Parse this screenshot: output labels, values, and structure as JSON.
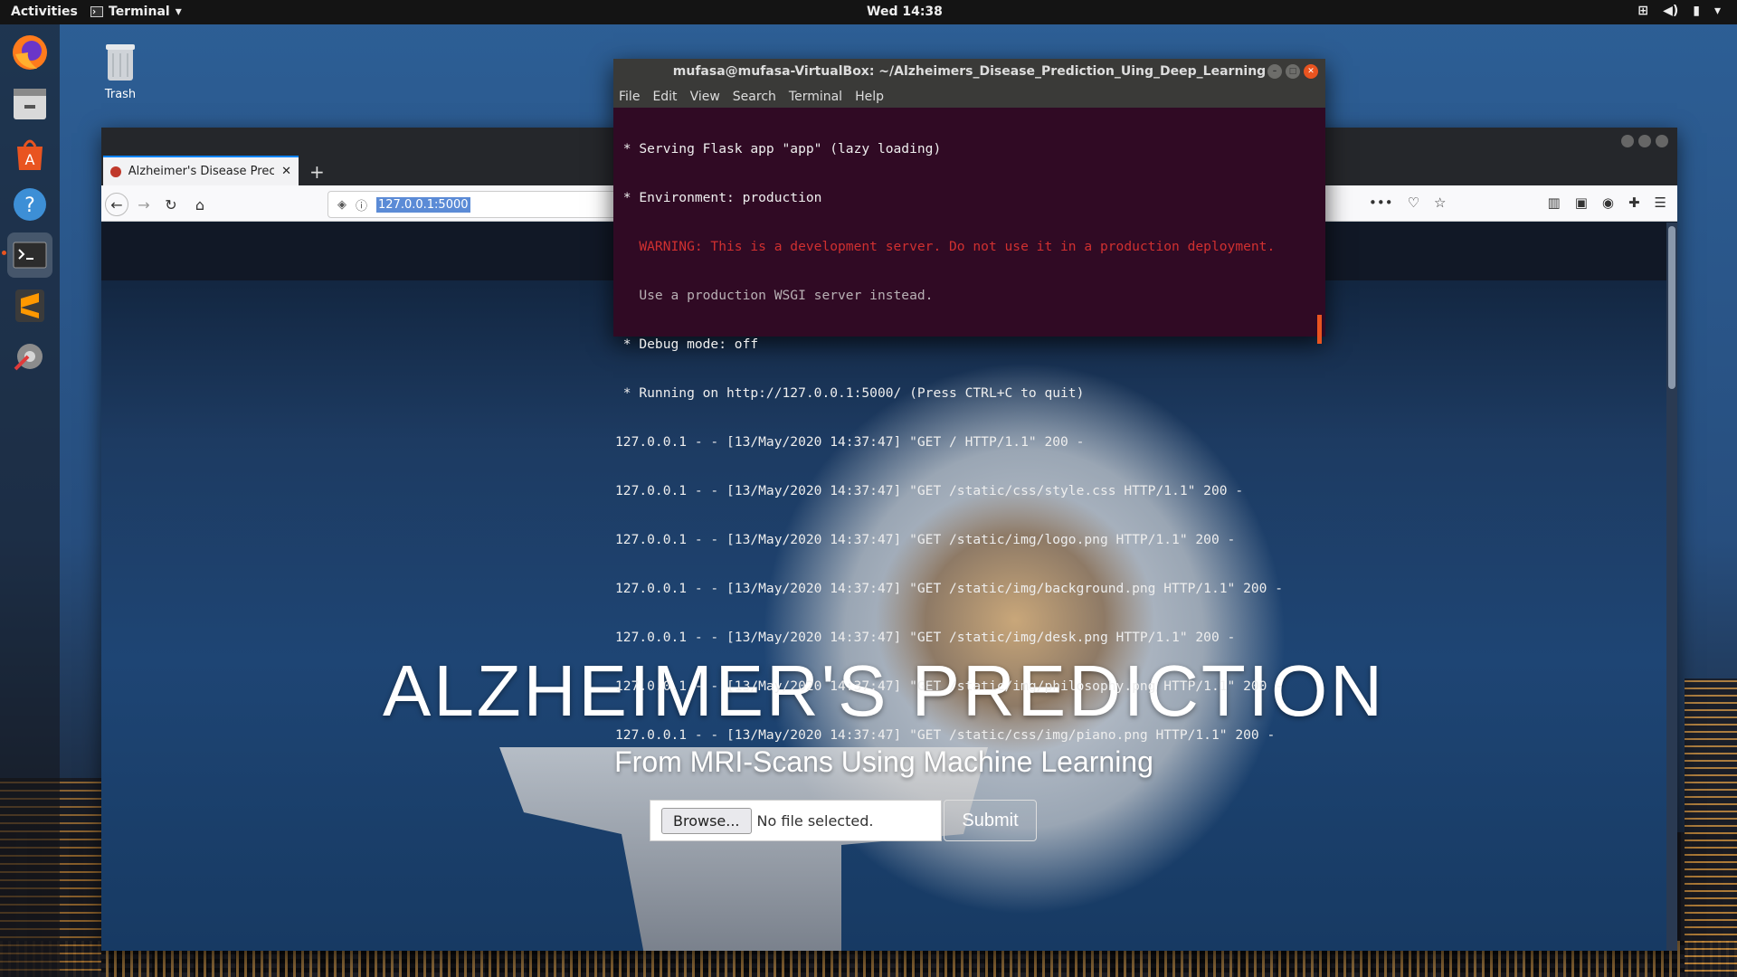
{
  "topbar": {
    "activities": "Activities",
    "app_name": "Terminal",
    "clock": "Wed 14:38"
  },
  "desktop": {
    "trash_label": "Trash"
  },
  "dock": {
    "items": [
      "firefox",
      "files",
      "software",
      "help",
      "terminal",
      "sublime-text",
      "settings"
    ]
  },
  "terminal": {
    "title": "mufasa@mufasa-VirtualBox: ~/Alzheimers_Disease_Prediction_Uing_Deep_Learning",
    "menu": [
      "File",
      "Edit",
      "View",
      "Search",
      "Terminal",
      "Help"
    ],
    "lines": [
      {
        "text": " * Serving Flask app \"app\" (lazy loading)",
        "style": "normal"
      },
      {
        "text": " * Environment: production",
        "style": "normal"
      },
      {
        "text": "   WARNING: This is a development server. Do not use it in a production deployment.",
        "style": "warn"
      },
      {
        "text": "   Use a production WSGI server instead.",
        "style": "dim"
      },
      {
        "text": " * Debug mode: off",
        "style": "normal"
      },
      {
        "text": " * Running on http://127.0.0.1:5000/ (Press CTRL+C to quit)",
        "style": "normal"
      },
      {
        "text": "127.0.0.1 - - [13/May/2020 14:37:47] \"GET / HTTP/1.1\" 200 -",
        "style": "normal"
      },
      {
        "text": "127.0.0.1 - - [13/May/2020 14:37:47] \"GET /static/css/style.css HTTP/1.1\" 200 -",
        "style": "normal"
      },
      {
        "text": "127.0.0.1 - - [13/May/2020 14:37:47] \"GET /static/img/logo.png HTTP/1.1\" 200 -",
        "style": "normal"
      },
      {
        "text": "127.0.0.1 - - [13/May/2020 14:37:47] \"GET /static/img/background.png HTTP/1.1\" 200 -",
        "style": "normal"
      },
      {
        "text": "127.0.0.1 - - [13/May/2020 14:37:47] \"GET /static/img/desk.png HTTP/1.1\" 200 -",
        "style": "normal"
      },
      {
        "text": "127.0.0.1 - - [13/May/2020 14:37:47] \"GET /static/img/philosophy.png HTTP/1.1\" 200 -",
        "style": "normal"
      },
      {
        "text": "127.0.0.1 - - [13/May/2020 14:37:47] \"GET /static/css/img/piano.png HTTP/1.1\" 200 -",
        "style": "normal"
      }
    ]
  },
  "browser": {
    "tab_title": "Alzheimer's Disease Prec",
    "new_tab": "+",
    "url": "127.0.0.1:5000",
    "page": {
      "title": "ALZHEIMER'S PREDICTION",
      "subtitle": "From MRI-Scans Using Machine Learning",
      "browse_label": "Browse...",
      "file_status": "No file selected.",
      "submit_label": "Submit"
    }
  },
  "colors": {
    "ubuntu_orange": "#e95420",
    "terminal_bg": "#300a24",
    "warning_red": "#d03030"
  }
}
